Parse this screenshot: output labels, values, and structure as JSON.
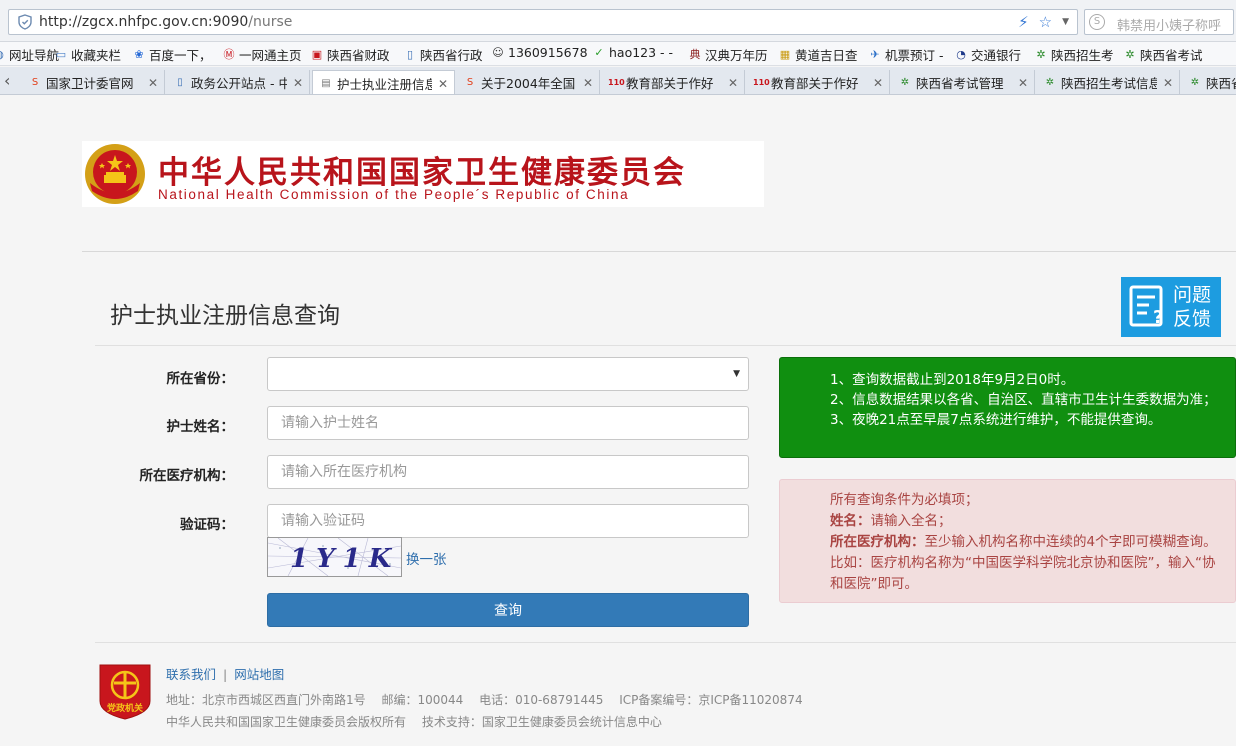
{
  "browser": {
    "url_host": "http://zgcx.nhfpc.gov.cn:9090",
    "url_path": "/nurse",
    "search_placeholder": "韩禁用小姨子称呼",
    "bookmarks": [
      {
        "label": "网址导航",
        "icon": "globe-icon"
      },
      {
        "label": "收藏夹栏",
        "icon": "folder-icon"
      },
      {
        "label": "百度一下，",
        "icon": "baidu-icon"
      },
      {
        "label": "一网通主页",
        "icon": "cmb-icon"
      },
      {
        "label": "陕西省财政",
        "icon": "gov-icon"
      },
      {
        "label": "陕西省行政",
        "icon": "page-icon"
      },
      {
        "label": "1360915678",
        "icon": "user-icon"
      },
      {
        "label": "hao123 -  -",
        "icon": "hao-icon"
      },
      {
        "label": "汉典万年历",
        "icon": "dict-icon"
      },
      {
        "label": "黄道吉日查",
        "icon": "calendar-icon"
      },
      {
        "label": "机票预订 -",
        "icon": "plane-icon"
      },
      {
        "label": "交通银行",
        "icon": "bank-icon"
      },
      {
        "label": "陕西招生考",
        "icon": "exam-icon"
      },
      {
        "label": "陕西省考试",
        "icon": "exam-icon"
      }
    ],
    "tabs": [
      {
        "label": "国家卫计委官网",
        "icon": "s-icon",
        "active": false
      },
      {
        "label": "政务公开站点 - 中",
        "icon": "page-icon",
        "active": false
      },
      {
        "label": "护士执业注册信息",
        "icon": "doc-icon",
        "active": true
      },
      {
        "label": "关于2004年全国",
        "icon": "s-icon",
        "active": false
      },
      {
        "label": "教育部关于作好",
        "icon": "110-icon",
        "active": false
      },
      {
        "label": "教育部关于作好",
        "icon": "110-icon",
        "active": false
      },
      {
        "label": "陕西省考试管理",
        "icon": "exam-icon",
        "active": false
      },
      {
        "label": "陕西招生考试信息",
        "icon": "exam-icon",
        "active": false
      },
      {
        "label": "陕西省考",
        "icon": "exam-icon",
        "active": false
      }
    ]
  },
  "header": {
    "logo_cn": "中华人民共和国国家卫生健康委员会",
    "logo_en": "National Health Commission of the People´s Republic of China"
  },
  "page": {
    "title": "护士执业注册信息查询",
    "feedback_line1": "问题",
    "feedback_line2": "反馈"
  },
  "form": {
    "province_label": "所在省份：",
    "province_value": "",
    "name_label": "护士姓名：",
    "name_placeholder": "请输入护士姓名",
    "institution_label": "所在医疗机构：",
    "institution_placeholder": "请输入所在医疗机构",
    "captcha_label": "验证码：",
    "captcha_placeholder": "请输入验证码",
    "captcha_text": "1Y1K",
    "captcha_refresh": "换一张",
    "submit_label": "查询"
  },
  "notice": {
    "lines": [
      "1、查询数据截止到2018年9月2日0时。",
      "2、信息数据结果以各省、自治区、直辖市卫生计生委数据为准；",
      "3、夜晚21点至早晨7点系统进行维护，不能提供查询。"
    ]
  },
  "hint": {
    "line1": "所有查询条件为必填项；",
    "name_key": "姓名：",
    "name_val": "请输入全名；",
    "inst_key": "所在医疗机构：",
    "inst_val": "至少输入机构名称中连续的4个字即可模糊查询。比如：医疗机构名称为“中国医学科学院北京协和医院”，输入“协和医院”即可。"
  },
  "footer": {
    "contact": "联系我们",
    "sitemap": "网站地图",
    "address": "地址：北京市西城区西直门外南路1号　 邮编：100044　 电话：010-68791445　 ICP备案编号：京ICP备11020874",
    "copyright": "中华人民共和国国家卫生健康委员会版权所有　 技术支持：国家卫生健康委员会统计信息中心",
    "badge_text": "党政机关"
  }
}
